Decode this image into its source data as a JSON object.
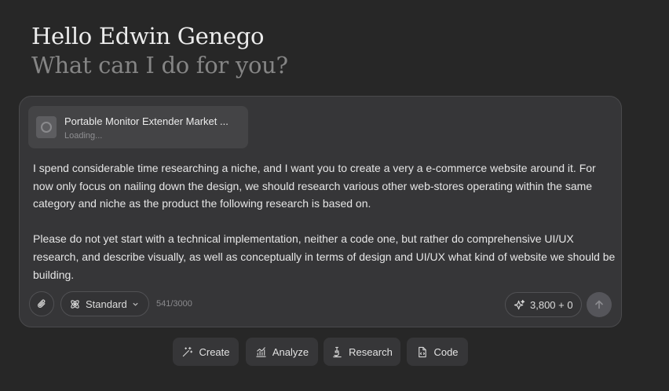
{
  "greeting": {
    "title": "Hello Edwin Genego",
    "subtitle": "What can I do for you?"
  },
  "attachment": {
    "icon": "file-loading-icon",
    "name": "Portable Monitor Extender Market ...",
    "status": "Loading..."
  },
  "message": {
    "paragraphs": [
      "I spend considerable time researching a niche, and I want you to create a very a e-commerce website around it. For now only focus on nailing down the design, we should research various other web-stores operating within the same category and niche as the product the following research is based on.",
      "Please do not yet start with a technical implementation, neither a code one, but rather do comprehensive UI/UX research, and describe visually, as well as conceptually in terms of design and UI/UX what kind of website we should be building."
    ]
  },
  "toolbar": {
    "attach_icon": "paperclip-icon",
    "mode_label": "Standard",
    "mode_icon": "atom-icon",
    "char_count": "541/3000",
    "credits_label": "3,800 + 0",
    "credits_icon": "sparkle-icon",
    "send_icon": "arrow-up-icon"
  },
  "actions": [
    {
      "label": "Create",
      "icon": "magic-wand-icon"
    },
    {
      "label": "Analyze",
      "icon": "chart-icon"
    },
    {
      "label": "Research",
      "icon": "microscope-icon"
    },
    {
      "label": "Code",
      "icon": "code-file-icon"
    }
  ],
  "colors": {
    "background": "#272727",
    "panel": "#363638",
    "muted_text": "#858585"
  }
}
